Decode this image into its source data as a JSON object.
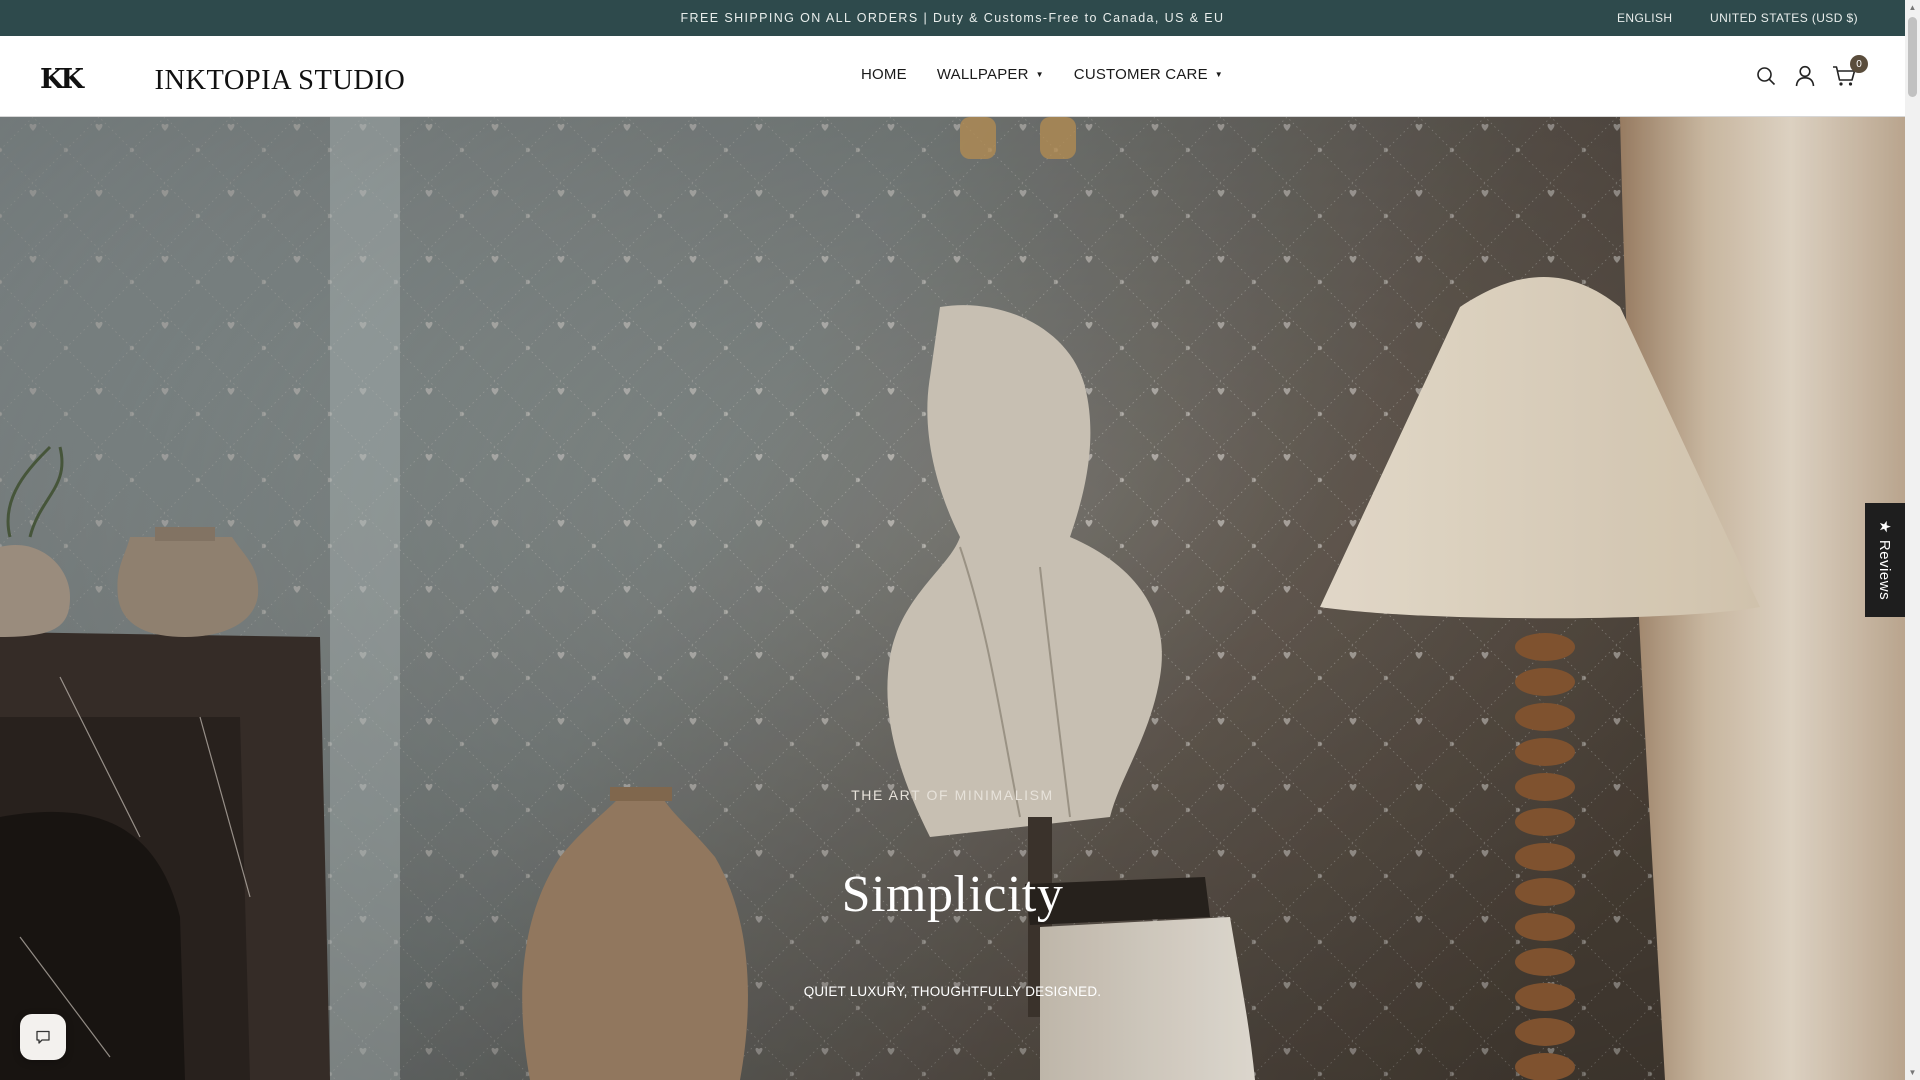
{
  "announcement": {
    "message": "FREE SHIPPING ON ALL ORDERS | Duty & Customs-Free to Canada, US & EU",
    "language": "ENGLISH",
    "country": "UNITED STATES (USD $)"
  },
  "header": {
    "logo_mark": "KK",
    "logo_text": "INKTOPIA STUDIO",
    "nav": [
      {
        "label": "HOME",
        "has_dropdown": false
      },
      {
        "label": "WALLPAPER",
        "has_dropdown": true
      },
      {
        "label": "CUSTOMER CARE",
        "has_dropdown": true
      }
    ],
    "icons": [
      "search-icon",
      "account-icon",
      "cart-icon"
    ],
    "cart_count": "0"
  },
  "hero": {
    "eyebrow": "THE ART OF MINIMALISM",
    "title": "Simplicity",
    "subtitle": "QUIET LUXURY, THOUGHTFULLY DESIGNED."
  },
  "reviews_tab": {
    "star": "★",
    "label": "Reviews"
  },
  "chat": {
    "icon": "chat-icon"
  },
  "colors": {
    "announcement_bg": "#2e4a4c",
    "cart_badge": "#5a4d3c"
  }
}
